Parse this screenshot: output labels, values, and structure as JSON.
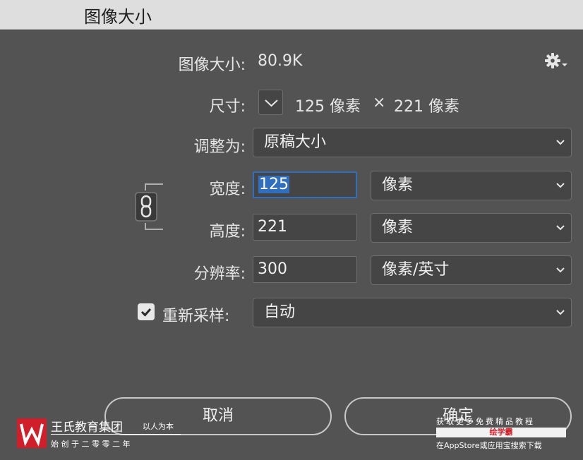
{
  "window": {
    "title": "图像大小"
  },
  "info": {
    "label": "图像大小:",
    "value": "80.9K"
  },
  "dimensions": {
    "label": "尺寸:",
    "width_value": "125 像素",
    "times": "×",
    "height_value": "221 像素"
  },
  "fit_to": {
    "label": "调整为:",
    "value": "原稿大小"
  },
  "width": {
    "label": "宽度:",
    "value": "125",
    "unit": "像素"
  },
  "height": {
    "label": "高度:",
    "value": "221",
    "unit": "像素"
  },
  "resolution": {
    "label": "分辨率:",
    "value": "300",
    "unit": "像素/英寸"
  },
  "resample": {
    "label": "重新采样:",
    "checked": true,
    "value": "自动"
  },
  "buttons": {
    "cancel": "取消",
    "ok": "确定"
  },
  "watermark_left": {
    "brand": "王氏教育集团",
    "slogan": "以人为本",
    "founded": "始 创 于 二 零 零 二 年"
  },
  "watermark_right": {
    "line1": "获取更多免费精品教程",
    "app": "绘学霸",
    "line3": "在AppStore或应用宝搜索下载"
  },
  "icons": {
    "gear": "gear-icon",
    "dimensions_toggle": "chevron-down-icon",
    "link": "chain-link-icon",
    "checkbox": "checkmark-icon",
    "select_arrow": "chevron-down-icon"
  },
  "colors": {
    "panel": "#535353",
    "field": "#454545",
    "focus": "#2f6fbe",
    "titlebar": "#dedede",
    "logo": "#d01f2a"
  }
}
